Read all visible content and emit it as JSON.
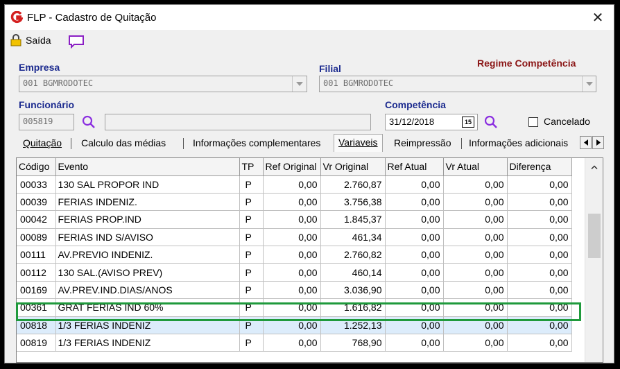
{
  "window": {
    "title": "FLP - Cadastro de Quitação",
    "close": "✕"
  },
  "toolbar": {
    "saida_label": "Saída"
  },
  "empresa": {
    "label": "Empresa",
    "value": "001 BGMRODOTEC"
  },
  "filial": {
    "label": "Filial",
    "value": "001 BGMRODOTEC"
  },
  "regime": {
    "label": "Regime Competência"
  },
  "funcionario": {
    "label": "Funcionário",
    "code": "005819",
    "name": ""
  },
  "competencia": {
    "label": "Competência",
    "value": "31/12/2018",
    "cal": "15"
  },
  "cancelado": {
    "label": "Cancelado",
    "checked": false
  },
  "tabs": [
    {
      "label": "Quitação",
      "active": false
    },
    {
      "label": "Calculo das médias",
      "active": false
    },
    {
      "label": "Informações complementares",
      "active": false
    },
    {
      "label": "Variaveis",
      "active": true
    },
    {
      "label": "Reimpressão",
      "active": false
    },
    {
      "label": "Informações adicionais",
      "active": false
    }
  ],
  "grid": {
    "columns": [
      "Código",
      "Evento",
      "TP",
      "Ref Original",
      "Vr Original",
      "Ref Atual",
      "Vr Atual",
      "Diferença"
    ],
    "rows": [
      [
        "00033",
        "130 SAL PROPOR IND",
        "P",
        "0,00",
        "2.760,87",
        "0,00",
        "0,00",
        "0,00"
      ],
      [
        "00039",
        "FERIAS INDENIZ.",
        "P",
        "0,00",
        "3.756,38",
        "0,00",
        "0,00",
        "0,00"
      ],
      [
        "00042",
        "FERIAS PROP.IND",
        "P",
        "0,00",
        "1.845,37",
        "0,00",
        "0,00",
        "0,00"
      ],
      [
        "00089",
        "FERIAS IND S/AVISO",
        "P",
        "0,00",
        "461,34",
        "0,00",
        "0,00",
        "0,00"
      ],
      [
        "00111",
        "AV.PREVIO INDENIZ.",
        "P",
        "0,00",
        "2.760,82",
        "0,00",
        "0,00",
        "0,00"
      ],
      [
        "00112",
        "130 SAL.(AVISO PREV)",
        "P",
        "0,00",
        "460,14",
        "0,00",
        "0,00",
        "0,00"
      ],
      [
        "00169",
        "AV.PREV.IND.DIAS/ANOS",
        "P",
        "0,00",
        "3.036,90",
        "0,00",
        "0,00",
        "0,00"
      ],
      [
        "00361",
        "GRAT FERIAS IND 60%",
        "P",
        "0,00",
        "1.616,82",
        "0,00",
        "0,00",
        "0,00"
      ],
      [
        "00818",
        "1/3 FERIAS INDENIZ",
        "P",
        "0,00",
        "1.252,13",
        "0,00",
        "0,00",
        "0,00"
      ],
      [
        "00819",
        "1/3 FERIAS INDENIZ",
        "P",
        "0,00",
        "768,90",
        "0,00",
        "0,00",
        "0,00"
      ]
    ],
    "selected_row": 8
  },
  "colors": {
    "label_blue": "#1c2b8f",
    "label_red": "#8b1616",
    "highlight": "#1f9a3c",
    "selected": "#dcecfb"
  }
}
